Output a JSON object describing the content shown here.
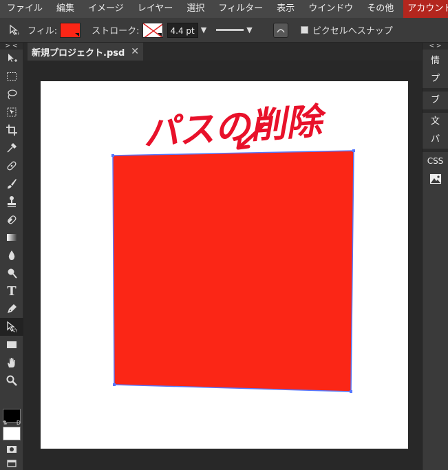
{
  "menubar": {
    "items": [
      "ファイル",
      "編集",
      "イメージ",
      "レイヤー",
      "選択",
      "フィルター",
      "表示",
      "ウインドウ",
      "その他"
    ],
    "account": "アカウント"
  },
  "options": {
    "fill_label": "フィル:",
    "fill_color": "#fb2616",
    "stroke_label": "ストローク:",
    "stroke_width": "4.4 pt",
    "snap_label": "ピクセルへスナップ"
  },
  "toolpanel": {
    "toggle": "> <",
    "swap_left": "⇅",
    "swap_right": "D"
  },
  "document": {
    "tab_name": "新規プロジェクト.psd",
    "close_glyph": "✕"
  },
  "annotation": {
    "text": "パスの削除",
    "color": "#e8112a"
  },
  "shape": {
    "fill": "#fb2616",
    "path_color": "#5577ff"
  },
  "rightpanel": {
    "toggle": "< >",
    "items": [
      "情",
      "プ",
      "ブ",
      "文",
      "パ",
      "CSS"
    ]
  }
}
